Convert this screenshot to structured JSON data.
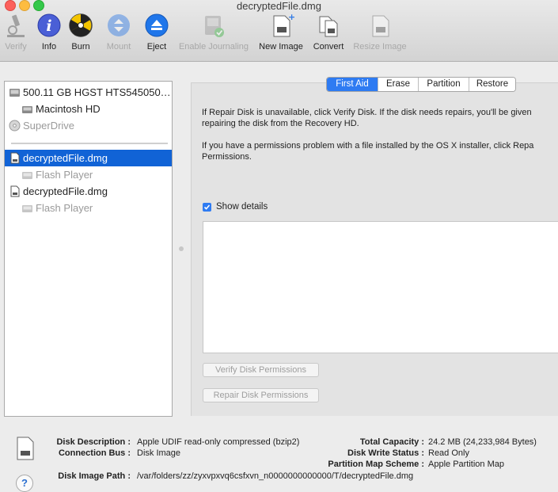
{
  "window": {
    "title": "decryptedFile.dmg"
  },
  "toolbar": [
    {
      "label": "Verify",
      "icon": "microscope-icon",
      "enabled": false
    },
    {
      "label": "Info",
      "icon": "info-icon",
      "enabled": true
    },
    {
      "label": "Burn",
      "icon": "burn-icon",
      "enabled": true
    },
    {
      "label": "Mount",
      "icon": "mount-icon",
      "enabled": false
    },
    {
      "label": "Eject",
      "icon": "eject-icon",
      "enabled": true
    },
    {
      "label": "Enable Journaling",
      "icon": "journaling-icon",
      "enabled": false
    },
    {
      "label": "New Image",
      "icon": "new-image-icon",
      "enabled": true
    },
    {
      "label": "Convert",
      "icon": "convert-icon",
      "enabled": true
    },
    {
      "label": "Resize Image",
      "icon": "resize-image-icon",
      "enabled": false
    }
  ],
  "sidebar": {
    "items": [
      {
        "label": "500.11 GB HGST HTS545050…",
        "type": "disk"
      },
      {
        "label": "Macintosh HD",
        "type": "volume"
      },
      {
        "label": "SuperDrive",
        "type": "optical"
      },
      {
        "label": "decryptedFile.dmg",
        "type": "image",
        "selected": true
      },
      {
        "label": "Flash Player",
        "type": "volume-dim"
      },
      {
        "label": "decryptedFile.dmg",
        "type": "image"
      },
      {
        "label": "Flash Player",
        "type": "volume-dim"
      }
    ]
  },
  "tabs": [
    {
      "label": "First Aid",
      "active": true
    },
    {
      "label": "Erase"
    },
    {
      "label": "Partition"
    },
    {
      "label": "Restore"
    }
  ],
  "first_aid": {
    "para1_line1": "If Repair Disk is unavailable, click Verify Disk. If the disk needs repairs, you'll be given",
    "para1_line2": "repairing the disk from the Recovery HD.",
    "para2_line1": "If you have a permissions problem with a file installed by the OS X installer, click Repa",
    "para2_line2": "Permissions.",
    "show_details_label": "Show details",
    "show_details_checked": true,
    "verify_perms_label": "Verify Disk Permissions",
    "repair_perms_label": "Repair Disk Permissions"
  },
  "info": {
    "disk_description_label": "Disk Description :",
    "disk_description": "Apple UDIF read-only compressed (bzip2)",
    "connection_bus_label": "Connection Bus :",
    "connection_bus": "Disk Image",
    "disk_image_path_label": "Disk Image Path :",
    "disk_image_path": "/var/folders/zz/zyxvpxvq6csfxvn_n0000000000000/T/decryptedFile.dmg",
    "total_capacity_label": "Total Capacity :",
    "total_capacity": "24.2 MB (24,233,984 Bytes)",
    "disk_write_status_label": "Disk Write Status :",
    "disk_write_status": "Read Only",
    "partition_map_label": "Partition Map Scheme :",
    "partition_map": "Apple Partition Map"
  },
  "help": {
    "glyph": "?"
  },
  "colors": {
    "selection": "#1163d6",
    "accent": "#2e7bf2"
  }
}
